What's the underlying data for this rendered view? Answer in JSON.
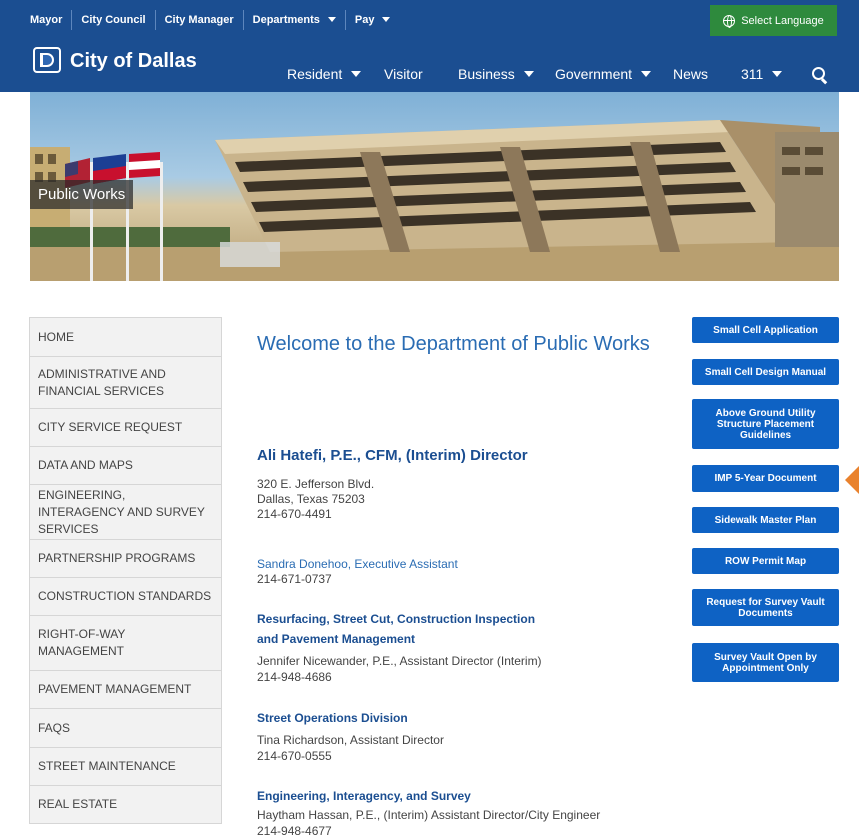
{
  "utility_nav": {
    "links": [
      "Mayor",
      "City Council",
      "City Manager"
    ],
    "departments": "Departments",
    "pay": "Pay",
    "language": "Select Language"
  },
  "header": {
    "site_title": "City of Dallas",
    "nav": [
      "Resident",
      "Visitor",
      "Business",
      "Government",
      "News",
      "311"
    ]
  },
  "hero": {
    "label": "Public Works"
  },
  "sidebar": {
    "items": [
      "HOME",
      "ADMINISTRATIVE AND FINANCIAL SERVICES",
      "CITY SERVICE REQUEST",
      "DATA AND MAPS",
      "ENGINEERING, INTERAGENCY AND SURVEY SERVICES",
      "PARTNERSHIP PROGRAMS",
      "CONSTRUCTION STANDARDS",
      "RIGHT-OF-WAY MANAGEMENT",
      "PAVEMENT MANAGEMENT",
      "FAQS",
      "STREET MAINTENANCE",
      "REAL ESTATE"
    ]
  },
  "main": {
    "welcome": "Welcome to the Department of Public Works",
    "director": {
      "name": "Ali Hatefi, P.E., CFM, (Interim) Director",
      "address1": "320 E. Jefferson Blvd.",
      "address2": "Dallas, Texas 75203",
      "phone": "214-670-4491"
    },
    "assistant": {
      "name": "Sandra Donehoo, Executive Assistant",
      "phone": "214-671-0737"
    },
    "resurfacing": {
      "title1": "Resurfacing, Street Cut, Construction Inspection",
      "title2": "and Pavement Management",
      "person": "Jennifer Nicewander, P.E., Assistant Director (Interim)",
      "phone": "214-948-4686"
    },
    "street_ops": {
      "title": "Street Operations Division",
      "person": "Tina Richardson, Assistant Director",
      "phone": "214-670-0555"
    },
    "engineering": {
      "title": "Engineering, Interagency, and Survey",
      "person": "Haytham Hassan, P.E., (Interim) Assistant Director/City Engineer",
      "phone": "214-948-4677"
    }
  },
  "right_buttons": [
    "Small Cell Application",
    "Small Cell Design Manual",
    "Above Ground Utility Structure Placement Guidelines",
    "IMP 5-Year Document",
    "Sidewalk Master Plan",
    "ROW Permit Map",
    "Request for Survey Vault Documents",
    "Survey Vault Open by Appointment Only"
  ],
  "colors": {
    "header_bg": "#1b4e91",
    "language_btn": "#2e8a3d",
    "button_blue": "#0e62c4",
    "link_blue": "#2a6cb3",
    "arrow": "#e9822d"
  }
}
